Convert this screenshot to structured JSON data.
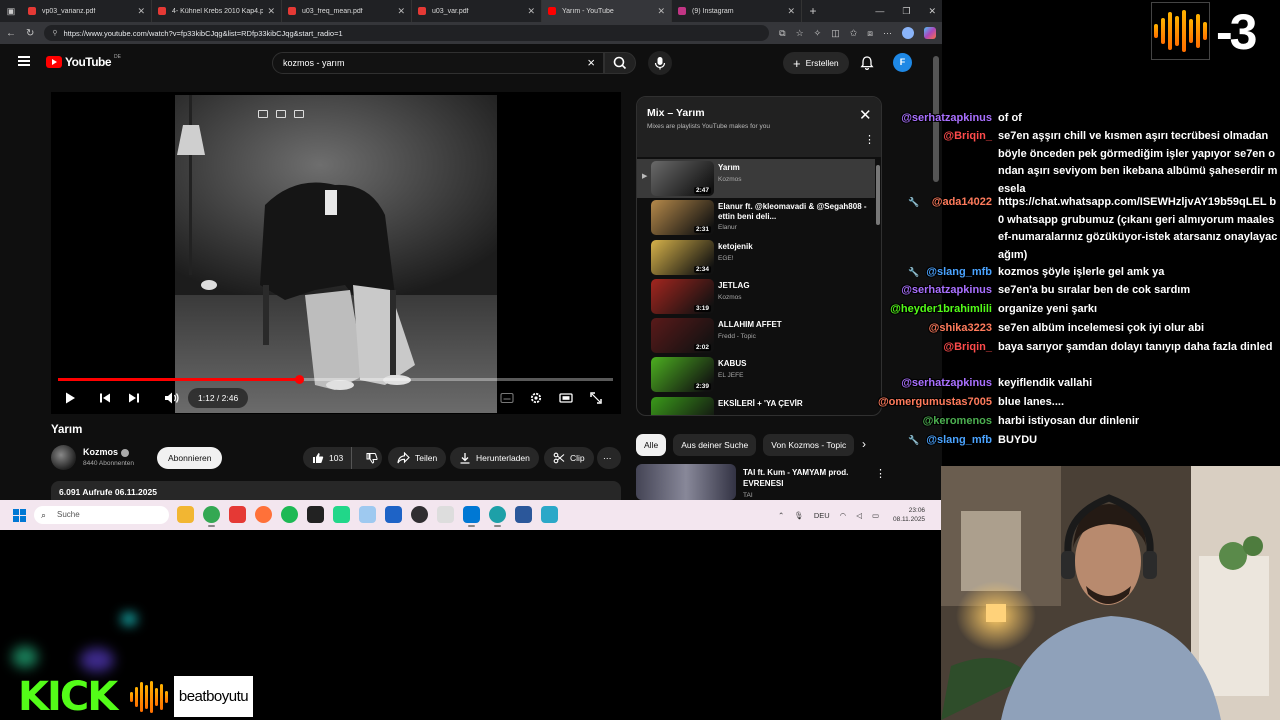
{
  "browser": {
    "tabs": [
      {
        "label": "vp03_varianz.pdf",
        "color": "#e53935"
      },
      {
        "label": "4- Kühnel Krebs 2010 Kap4.p",
        "color": "#e53935"
      },
      {
        "label": "u03_freq_mean.pdf",
        "color": "#e53935"
      },
      {
        "label": "u03_var.pdf",
        "color": "#e53935"
      },
      {
        "label": "Yarım - YouTube",
        "color": "#ff0000",
        "active": true
      },
      {
        "label": "(9) Instagram",
        "color": "#c13584"
      }
    ],
    "url": "https://www.youtube.com/watch?v=fp33kibCJqg&list=RDfp33kibCJqg&start_radio=1"
  },
  "youtube": {
    "logo_word": "YouTube",
    "logo_country": "DE",
    "search_value": "kozmos - yarım",
    "create_label": "Erstellen",
    "avatar_letter": "F",
    "player": {
      "time": "1:12 / 2:46",
      "progress_fraction": 0.434
    },
    "video": {
      "title": "Yarım",
      "channel": "Kozmos",
      "subs": "8440 Abonnenten",
      "subscribe_label": "Abonnieren",
      "likes": "103",
      "share_label": "Teilen",
      "download_label": "Herunterladen",
      "clip_label": "Clip",
      "stats": "6.091 Aufrufe  06.11.2025"
    },
    "mix": {
      "title": "Mix – Yarım",
      "subtitle": "Mixes are playlists YouTube makes for you",
      "items": [
        {
          "title": "Yarım",
          "artist": "Kozmos",
          "duration": "2:47",
          "current": true,
          "thumb": "#6a6a6a"
        },
        {
          "title": "Elanur ft. @kleomavadi & @Segah808 - ettin beni deli...",
          "artist": "Elanur",
          "duration": "2:31",
          "thumb": "#b5894a"
        },
        {
          "title": "ketojenik",
          "artist": "EGE!",
          "duration": "2:34",
          "thumb": "#d6b24a"
        },
        {
          "title": "JETLAG",
          "artist": "Kozmos",
          "duration": "3:19",
          "thumb": "#a3261f"
        },
        {
          "title": "ALLAHIM AFFET",
          "artist": "Fredd - Topic",
          "duration": "2:02",
          "thumb": "#5a1a1a"
        },
        {
          "title": "KABUS",
          "artist": "EL JEFE",
          "duration": "2:39",
          "thumb": "#4caf20"
        },
        {
          "title": "EKSİLERİ + 'YA ÇEVİR",
          "artist": "",
          "duration": "",
          "thumb": "#3a9a1a"
        }
      ]
    },
    "chips": [
      "Alle",
      "Aus deiner Suche",
      "Von Kozmos - Topic"
    ],
    "recommendation": {
      "title": "TAI ft. Kum - YAMYAM prod. EVRENESI",
      "channel": "TAI"
    }
  },
  "taskbar": {
    "search_placeholder": "Suche",
    "lang": "DEU",
    "time": "23:06",
    "date": "08.11.2025",
    "apps": [
      {
        "name": "file-explorer-icon",
        "color": "#f2b632"
      },
      {
        "name": "chrome-icon",
        "color": "#34a853"
      },
      {
        "name": "dev-app-icon",
        "color": "#e53935"
      },
      {
        "name": "firefox-icon",
        "color": "#ff7139"
      },
      {
        "name": "spotify-icon",
        "color": "#1db954"
      },
      {
        "name": "capcut-icon",
        "color": "#222222"
      },
      {
        "name": "pycharm-icon",
        "color": "#21d789"
      },
      {
        "name": "cloud-icon",
        "color": "#9ec9f0"
      },
      {
        "name": "shield-icon",
        "color": "#1e63c6"
      },
      {
        "name": "obs-icon",
        "color": "#302e31"
      },
      {
        "name": "document-icon",
        "color": "#dddddd"
      },
      {
        "name": "vscode-icon",
        "color": "#0078d4"
      },
      {
        "name": "edge-icon",
        "color": "#1da0a8"
      },
      {
        "name": "word-icon",
        "color": "#2b579a"
      },
      {
        "name": "calculator-icon",
        "color": "#2aa8c8"
      }
    ]
  },
  "chat": {
    "messages": [
      {
        "user": "@serhatzapkinus",
        "user_color": "#a970ff",
        "text": "of of",
        "mod": false
      },
      {
        "user": "@Briqin_",
        "user_color": "#ff4b4b",
        "text": "se7en aşşırı chill ve kısmen aşırı tecrübesi olmadan böyle önceden pek görmediğim işler yapıyor se7en ondan aşırı seviyom ben ikebana albümü şaheserdir mesela",
        "mod": false
      },
      {
        "user": "@ada14022",
        "user_color": "#ff7b5c",
        "text": "https://chat.whatsapp.com/ISEWHzljvAY19b59qLEL b0 whatsapp grubumuz (çıkanı geri almıyorum maalesef-numaralarınız gözüküyor-istek atarsanız onaylayacağım)",
        "mod": true
      },
      {
        "user": "@slang_mfb",
        "user_color": "#4aa3ff",
        "text": "kozmos şöyle işlerle gel amk ya",
        "mod": true
      },
      {
        "user": "@serhatzapkinus",
        "user_color": "#a970ff",
        "text": "se7en'a bu sıralar ben de cok sardım",
        "mod": false
      },
      {
        "user": "@heyder1brahimlili",
        "user_color": "#53fc18",
        "text": "organize yeni şarkı",
        "mod": false
      },
      {
        "user": "@shika3223",
        "user_color": "#ff7b5c",
        "text": "se7en albüm incelemesi çok iyi olur abi",
        "mod": false
      },
      {
        "user": "@Briqin_",
        "user_color": "#ff4b4b",
        "text": "baya sarıyor şamdan dolayı tanıyıp daha fazla dinled",
        "mod": false
      },
      {
        "user": "@serhatzapkinus",
        "user_color": "#a970ff",
        "text": "keyiflendik vallahi",
        "mod": false
      },
      {
        "user": "@omergumustas7005",
        "user_color": "#ff7b5c",
        "text": "blue lanes....",
        "mod": false
      },
      {
        "user": "@keromenos",
        "user_color": "#4caf50",
        "text": "harbi istiyosan dur dinlenir",
        "mod": false
      },
      {
        "user": "@slang_mfb",
        "user_color": "#4aa3ff",
        "text": "BUYDU",
        "mod": true
      }
    ]
  },
  "overlay": {
    "counter": "-3",
    "kick_label": "KICK",
    "brand_name": "beatboyutu",
    "kick_color": "#53fc18"
  }
}
